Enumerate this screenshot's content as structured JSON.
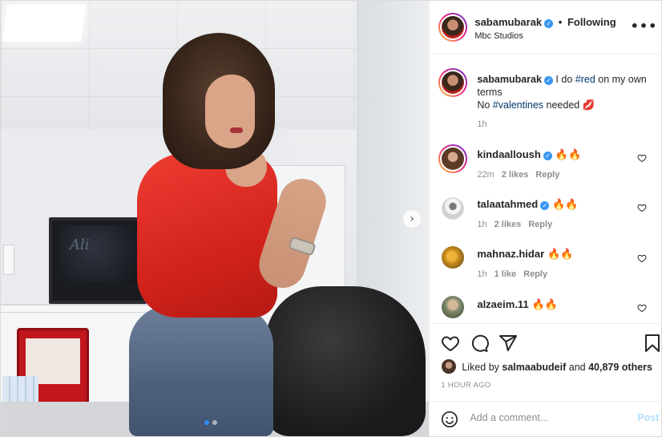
{
  "post": {
    "author": "sabamubarak",
    "follow_separator": "•",
    "follow_label": "Following",
    "location": "Mbc Studios",
    "more_label": "•••",
    "tv_logo": "Ali"
  },
  "caption": {
    "username": "sabamubarak",
    "text_before": " I do ",
    "hashtag1": "#red",
    "text_middle": " on my own terms",
    "line2_prefix": "No ",
    "hashtag2": "#valentines",
    "text_after": " needed 💋",
    "time": "1h"
  },
  "comments": [
    {
      "username": "kindaalloush",
      "verified": true,
      "text": "🔥🔥",
      "time": "22m",
      "likes": "2 likes",
      "reply": "Reply"
    },
    {
      "username": "talaatahmed",
      "verified": true,
      "text": "🔥🔥",
      "time": "1h",
      "likes": "2 likes",
      "reply": "Reply"
    },
    {
      "username": "mahnaz.hidar",
      "verified": false,
      "text": "🔥🔥",
      "time": "1h",
      "likes": "1 like",
      "reply": "Reply"
    },
    {
      "username": "alzaeim.11",
      "verified": false,
      "text": "🔥🔥",
      "time": "",
      "likes": "",
      "reply": ""
    }
  ],
  "likes": {
    "prefix": "Liked by ",
    "user": "salmaabudeif",
    "middle": " and ",
    "others": "40,879 others"
  },
  "posted_time": "1 HOUR AGO",
  "add_comment": {
    "placeholder": "Add a comment...",
    "post_label": "Post"
  },
  "carousel": {
    "next_icon": "chevron-right-icon",
    "slides": 2,
    "active_slide": 1
  },
  "colors": {
    "verified": "#3897f0",
    "hashtag": "#00376b",
    "muted": "#8e8e8e",
    "post_disabled": "#b2dffc",
    "carousel_active_dot": "#2f8cff"
  }
}
